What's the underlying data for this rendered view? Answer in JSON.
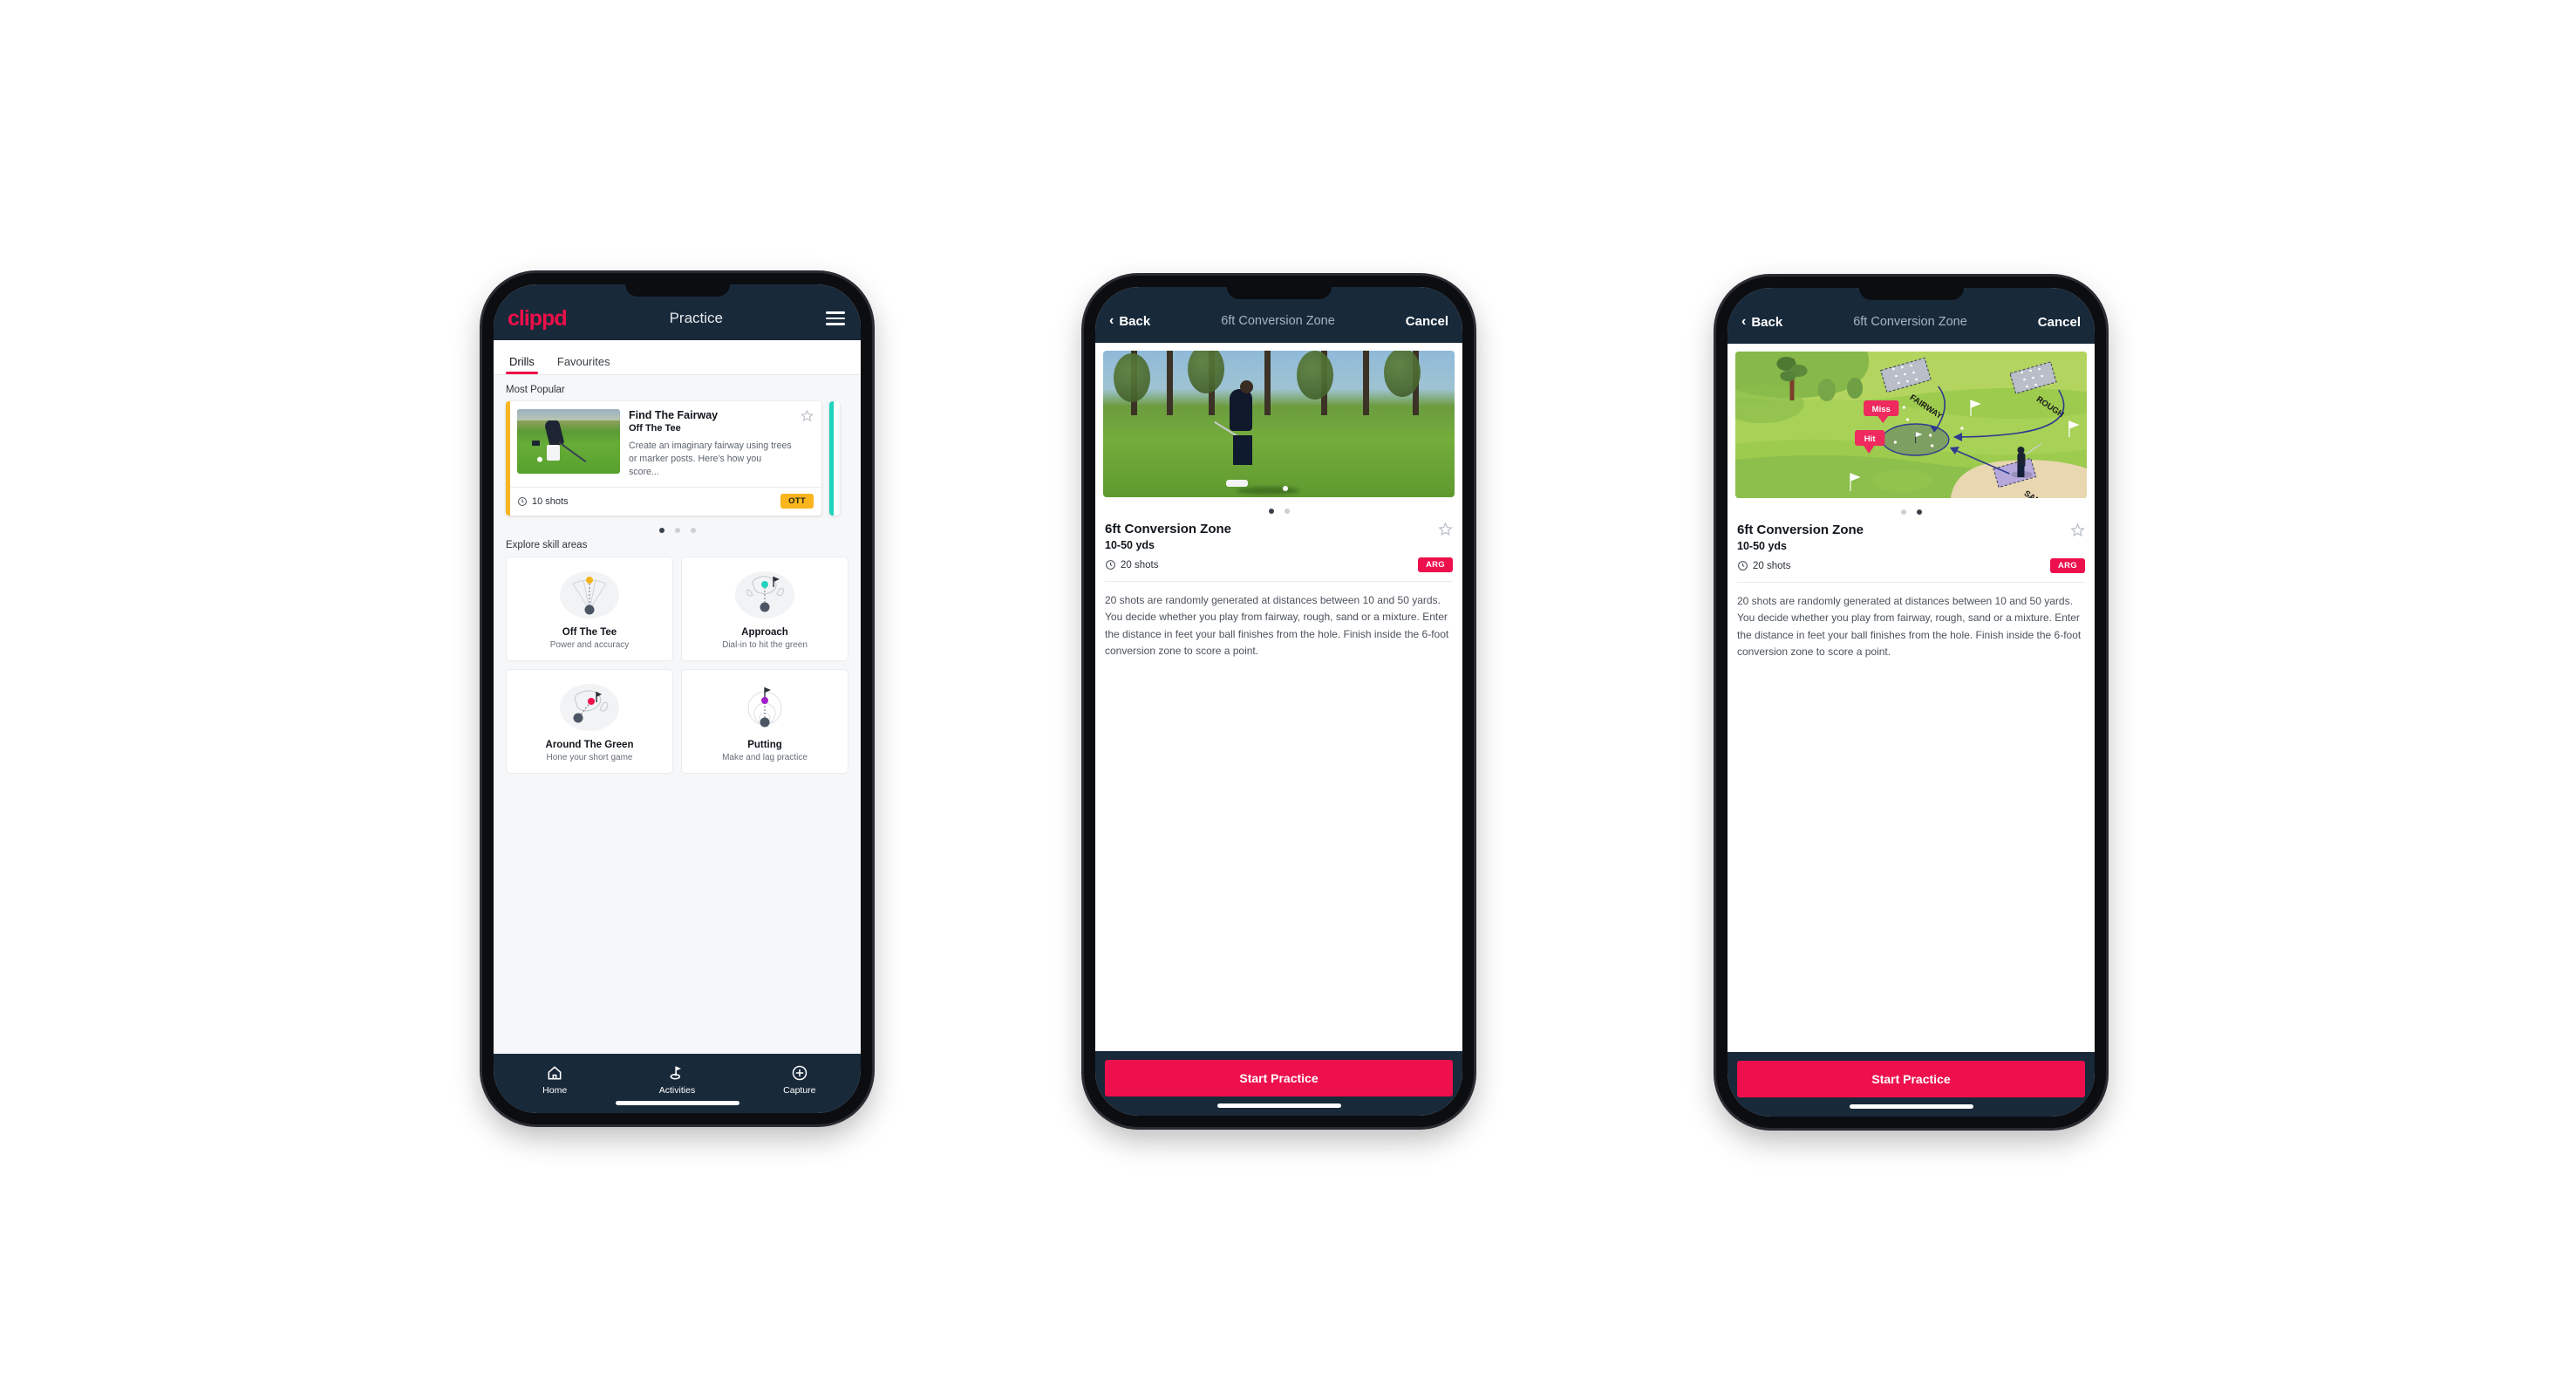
{
  "phone1": {
    "topbar": {
      "logo": "clippd",
      "title": "Practice",
      "menu_icon": "hamburger-menu-icon"
    },
    "tabs": [
      {
        "label": "Drills",
        "active": true
      },
      {
        "label": "Favourites",
        "active": false
      }
    ],
    "most_popular_heading": "Most Popular",
    "drill_card": {
      "title": "Find The Fairway",
      "subtitle": "Off The Tee",
      "description": "Create an imaginary fairway using trees or marker posts. Here's how you score...",
      "shots": "10 shots",
      "badge": "OTT",
      "badge_color": "#f8b51d",
      "favourite_icon": "star-outline-icon"
    },
    "carousel_dots": {
      "count": 3,
      "active": 0
    },
    "explore_heading": "Explore skill areas",
    "skills": [
      {
        "name": "Off The Tee",
        "desc": "Power and accuracy",
        "icon": "tee-fan-icon",
        "accent": "#f5b21a"
      },
      {
        "name": "Approach",
        "desc": "Dial-in to hit the green",
        "icon": "approach-green-icon",
        "accent": "#22d3be"
      },
      {
        "name": "Around The Green",
        "desc": "Hone your short game",
        "icon": "chip-green-icon",
        "accent": "#ee0f4d"
      },
      {
        "name": "Putting",
        "desc": "Make and lag practice",
        "icon": "putting-rings-icon",
        "accent": "#a020c8"
      }
    ],
    "nav": [
      {
        "label": "Home",
        "icon": "home-icon",
        "active": false
      },
      {
        "label": "Activities",
        "icon": "golf-flag-icon",
        "active": true
      },
      {
        "label": "Capture",
        "icon": "plus-circle-icon",
        "active": false
      }
    ]
  },
  "detail": {
    "topbar": {
      "back": "Back",
      "title": "6ft Conversion Zone",
      "cancel": "Cancel",
      "back_icon": "chevron-left-icon"
    },
    "title": "6ft Conversion Zone",
    "yardage": "10-50 yds",
    "shots": "20 shots",
    "shots_icon": "clock-icon",
    "badge": "ARG",
    "badge_color": "#ee0f4d",
    "favourite_icon": "star-outline-icon",
    "description": "20 shots are randomly generated at distances between 10 and 50 yards. You decide whether you play from fairway, rough, sand or a mixture. Enter the distance in feet your ball finishes from the hole. Finish inside the 6-foot conversion zone to score a point.",
    "cta": "Start Practice",
    "cta_color": "#ee0f4d"
  },
  "phone2": {
    "media_type": "photo",
    "media_alt": "golfer-chipping-photo",
    "dots": {
      "count": 2,
      "active": 0
    }
  },
  "phone3": {
    "media_type": "illustration",
    "media_alt": "golf-course-diagram",
    "dots": {
      "count": 2,
      "active": 1
    },
    "course_labels": {
      "fairway": "FAIRWAY",
      "rough": "ROUGH",
      "sand": "SAND",
      "miss": "Miss",
      "hit": "Hit"
    }
  },
  "theme": {
    "brand_pink": "#ed0f49",
    "dark_navy": "#18293a",
    "badge_yellow": "#f8b51d",
    "teal": "#22d3be"
  }
}
